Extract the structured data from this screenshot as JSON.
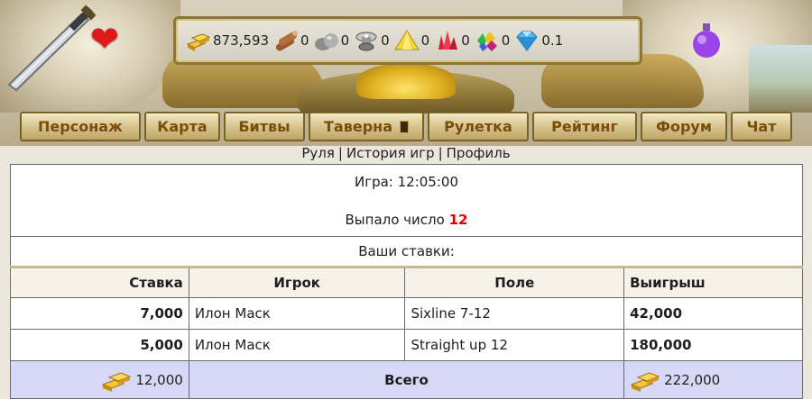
{
  "resources": {
    "gold": {
      "icon": "gold-bars-icon",
      "value": "873,593"
    },
    "wood": {
      "icon": "wood-logs-icon",
      "value": "0"
    },
    "stone": {
      "icon": "stone-icon",
      "value": "0"
    },
    "mercury": {
      "icon": "mercury-icon",
      "value": "0"
    },
    "sulfur": {
      "icon": "sulfur-icon",
      "value": "0"
    },
    "crystals": {
      "icon": "crystals-icon",
      "value": "0"
    },
    "gems": {
      "icon": "gems-icon",
      "value": "0"
    },
    "diamonds": {
      "icon": "diamond-icon",
      "value": "0.1"
    }
  },
  "nav": {
    "items": [
      {
        "label": "Персонаж"
      },
      {
        "label": "Карта"
      },
      {
        "label": "Битвы"
      },
      {
        "label": "Таверна"
      },
      {
        "label": "Рулетка"
      },
      {
        "label": "Рейтинг"
      },
      {
        "label": "Форум"
      },
      {
        "label": "Чат"
      }
    ]
  },
  "subnav": {
    "roulette": "Руля",
    "history": "История игр",
    "profile": "Профиль",
    "separator": "|"
  },
  "game": {
    "game_label": "Игра: 12:05:00",
    "rolled_label": "Выпало число",
    "rolled_number": "12",
    "bets_title": "Ваши ставки:"
  },
  "table": {
    "headers": {
      "bet": "Ставка",
      "player": "Игрок",
      "field": "Поле",
      "win": "Выигрыш"
    },
    "rows": [
      {
        "bet": "7,000",
        "player": "Илон Маск",
        "field": "Sixline 7-12",
        "win": "42,000"
      },
      {
        "bet": "5,000",
        "player": "Илон Маск",
        "field": "Straight up 12",
        "win": "180,000"
      }
    ],
    "total": {
      "bet": "12,000",
      "label": "Всего",
      "win": "222,000"
    }
  },
  "colors": {
    "accent_number": "#e00000",
    "total_row_bg": "#d7d8f6",
    "nav_text": "#7a4e0a"
  }
}
